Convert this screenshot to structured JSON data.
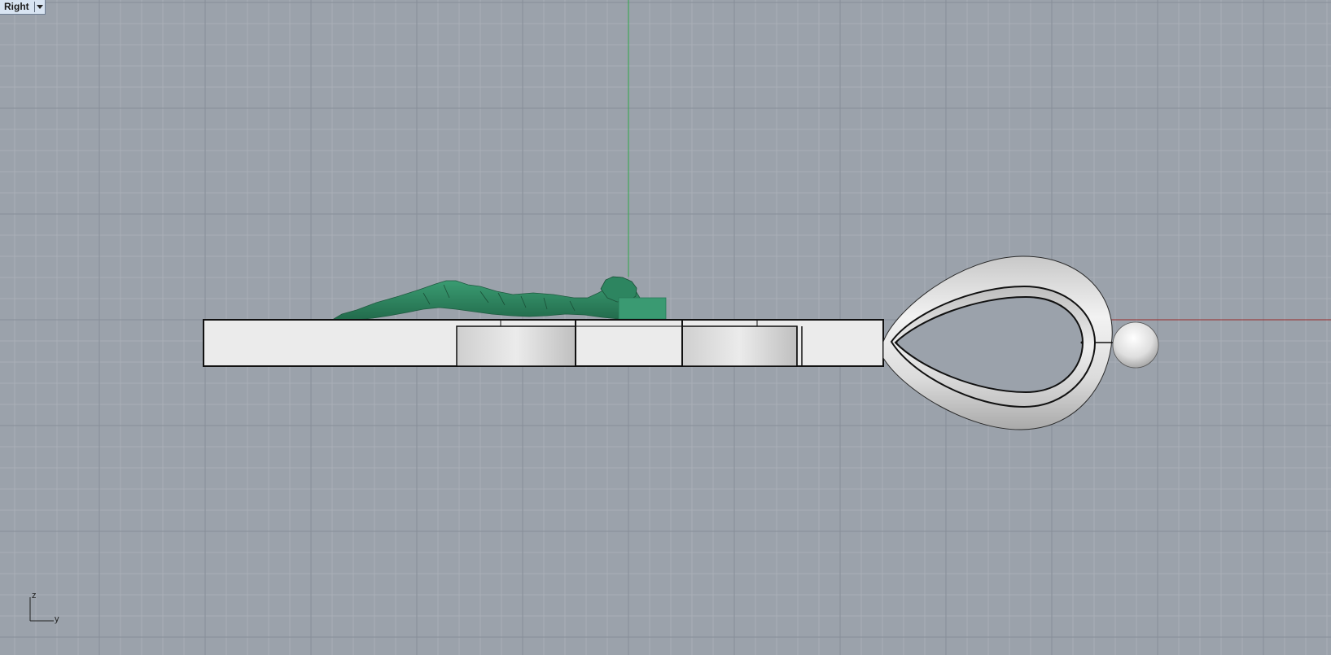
{
  "viewport": {
    "name": "Right",
    "menu_icon": "dropdown-triangle-icon",
    "background_color": "#9ba2ab",
    "grid_minor_color": "#a9afb7",
    "grid_major_color": "#878e98",
    "x_axis_color": "#9a2a2a",
    "z_axis_color": "#2fa84a"
  },
  "axis_indicator": {
    "vertical_label": "z",
    "horizontal_label": "y"
  },
  "objects": {
    "figure_color": "#2f8a64",
    "body_color": "#eaeaea",
    "outline_color": "#111111"
  }
}
